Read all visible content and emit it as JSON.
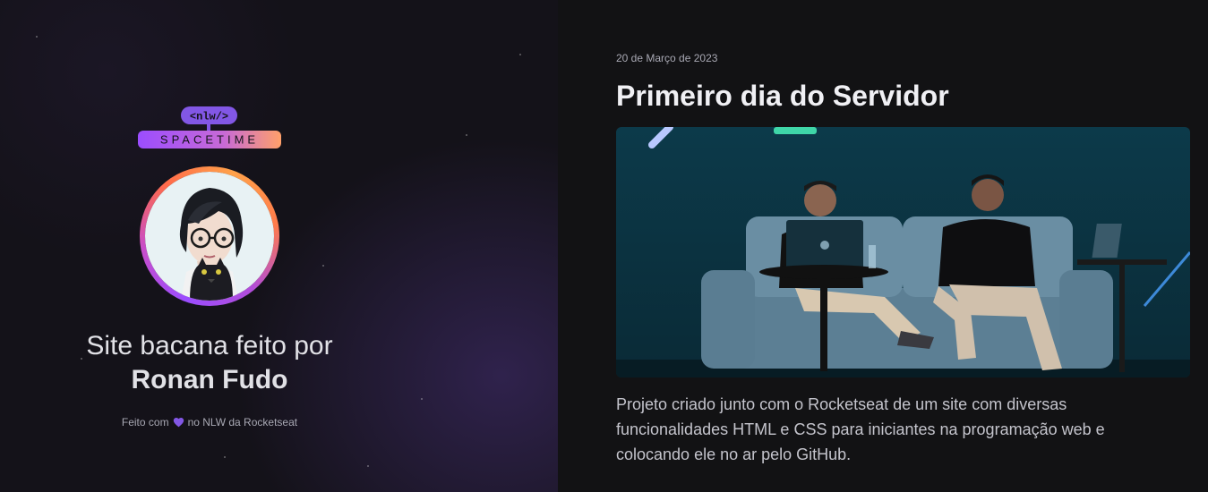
{
  "brand": {
    "logo_tag": "<nlw/>",
    "logo_word": "SPACETIME"
  },
  "profile": {
    "headline": "Site bacana feito por",
    "name": "Ronan Fudo",
    "avatar_icon": "avatar-portrait-with-cat"
  },
  "footer": {
    "prefix": "Feito com",
    "heart_icon": "heart-icon",
    "suffix": "no NLW da Rocketseat"
  },
  "memory": {
    "date": "20 de Março de 2023",
    "title": "Primeiro dia do Servidor",
    "image_icon": "stage-photo-two-presenters",
    "description": "Projeto criado junto com o Rocketseat de um site com diversas funcionalidades HTML e CSS para iniciantes na programação web e colocando ele no ar pelo GitHub."
  },
  "colors": {
    "heart": "#8257e5",
    "gradient_start": "#9b4dff",
    "gradient_end": "#ff7b4a",
    "text_primary": "#e1e1e6",
    "text_secondary": "#a8a8b3"
  }
}
